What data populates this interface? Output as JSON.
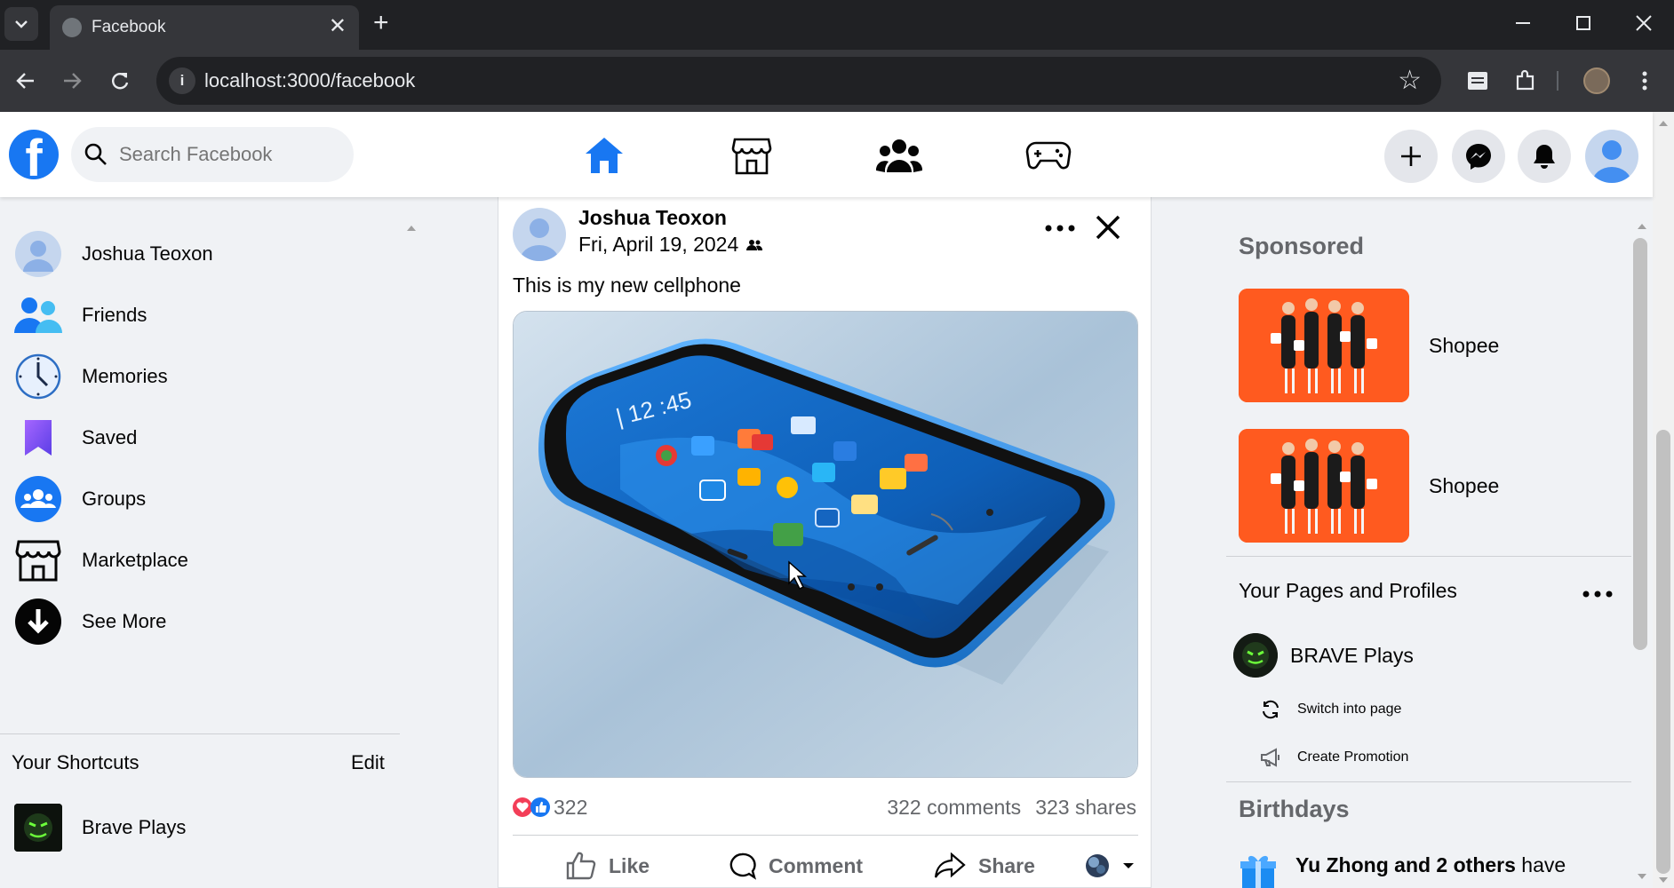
{
  "browser": {
    "tab_title": "Facebook",
    "url": "localhost:3000/facebook"
  },
  "header": {
    "logo_letter": "f",
    "search_placeholder": "Search Facebook",
    "nav": [
      "home-icon",
      "marketplace-icon",
      "groups-icon",
      "gaming-icon"
    ],
    "accent": "#1877f2"
  },
  "sidebar": {
    "items": [
      {
        "label": "Joshua Teoxon",
        "icon": "profile-avatar"
      },
      {
        "label": "Friends",
        "icon": "friends-icon"
      },
      {
        "label": "Memories",
        "icon": "clock-icon"
      },
      {
        "label": "Saved",
        "icon": "bookmark-icon"
      },
      {
        "label": "Groups",
        "icon": "groups-icon"
      },
      {
        "label": "Marketplace",
        "icon": "marketplace-icon"
      },
      {
        "label": "See More",
        "icon": "arrow-down-icon"
      }
    ],
    "shortcuts_title": "Your Shortcuts",
    "shortcuts_edit": "Edit",
    "shortcuts": [
      {
        "label": "Brave Plays"
      }
    ]
  },
  "post": {
    "author": "Joshua Teoxon",
    "date": "Fri, April 19, 2024",
    "text": "This is my new cellphone",
    "reaction_count": "322",
    "comments": "322 comments",
    "shares": "323 shares",
    "actions": {
      "like": "Like",
      "comment": "Comment",
      "share": "Share"
    }
  },
  "right": {
    "sponsored_title": "Sponsored",
    "ads": [
      {
        "label": "Shopee"
      },
      {
        "label": "Shopee"
      }
    ],
    "pages_title": "Your Pages and Profiles",
    "page_name": "BRAVE Plays",
    "switch_label": "Switch into page",
    "promo_label": "Create Promotion",
    "birthdays_title": "Birthdays",
    "birthday_names": "Yu Zhong and 2 others",
    "birthday_suffix": " have"
  }
}
